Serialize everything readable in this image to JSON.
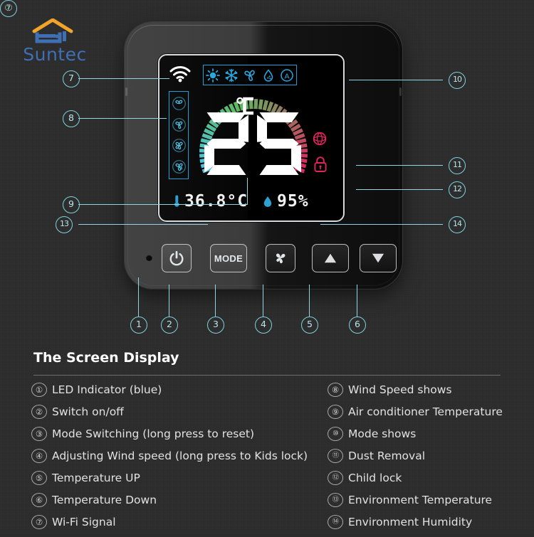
{
  "brand": {
    "name": "Suntec",
    "logo_colors": {
      "roof": "#f0a42a",
      "base": "#3f6fb5",
      "text": "#3f6fb5"
    }
  },
  "device": {
    "display": {
      "wifi_icon": "wifi-icon",
      "mode_icons": [
        {
          "name": "heat-mode-icon",
          "glyph": "sun"
        },
        {
          "name": "cool-mode-icon",
          "glyph": "snowflake"
        },
        {
          "name": "fan-mode-icon",
          "glyph": "fan"
        },
        {
          "name": "dehumidify-mode-icon",
          "glyph": "droplet"
        },
        {
          "name": "auto-mode-icon",
          "glyph": "A"
        }
      ],
      "fan_speed_icons": [
        {
          "name": "fan-speed-1-icon"
        },
        {
          "name": "fan-speed-2-icon"
        },
        {
          "name": "fan-speed-3-icon"
        },
        {
          "name": "fan-speed-4-icon"
        }
      ],
      "set_temperature": "25",
      "unit": "°C",
      "environment_temperature": "36.8°C",
      "environment_humidity": "95%",
      "dust_removal_icon": "dust-removal-icon",
      "child_lock_icon": "child-lock-icon",
      "arc_colors": {
        "cold": "#4ec3e8",
        "mid": "#5fb85f",
        "hot": "#e0245e"
      }
    },
    "buttons": [
      {
        "name": "power-button",
        "label": "",
        "glyph": "power"
      },
      {
        "name": "mode-button",
        "label": "MODE",
        "glyph": "text"
      },
      {
        "name": "fan-speed-button",
        "label": "",
        "glyph": "fan"
      },
      {
        "name": "temp-up-button",
        "label": "",
        "glyph": "up"
      },
      {
        "name": "temp-down-button",
        "label": "",
        "glyph": "down"
      }
    ],
    "led_indicator": "led-indicator"
  },
  "callouts": [
    {
      "id": "1",
      "pos": "bottom"
    },
    {
      "id": "2",
      "pos": "bottom"
    },
    {
      "id": "3",
      "pos": "bottom"
    },
    {
      "id": "4",
      "pos": "bottom"
    },
    {
      "id": "5",
      "pos": "bottom"
    },
    {
      "id": "6",
      "pos": "bottom"
    },
    {
      "id": "7",
      "pos": "left"
    },
    {
      "id": "8",
      "pos": "left"
    },
    {
      "id": "9",
      "pos": "left"
    },
    {
      "id": "13",
      "pos": "left"
    },
    {
      "id": "10",
      "pos": "right"
    },
    {
      "id": "11",
      "pos": "right"
    },
    {
      "id": "12",
      "pos": "right"
    },
    {
      "id": "14",
      "pos": "right"
    }
  ],
  "legend": {
    "title": "The Screen Display",
    "left": [
      {
        "num": "①",
        "text": "LED Indicator (blue)"
      },
      {
        "num": "②",
        "text": "Switch on/off"
      },
      {
        "num": "③",
        "text": "Mode Switching (long press to reset)"
      },
      {
        "num": "④",
        "text": "Adjusting Wind speed (long press to Kids lock)"
      },
      {
        "num": "⑤",
        "text": "Temperature UP"
      },
      {
        "num": "⑥",
        "text": "Temperature Down"
      },
      {
        "num": "⑦",
        "text": "Wi-Fi Signal"
      }
    ],
    "right": [
      {
        "num": "⑧",
        "text": "Wind Speed shows"
      },
      {
        "num": "⑨",
        "text": "Air conditioner Temperature"
      },
      {
        "num": "⑩",
        "text": "Mode shows"
      },
      {
        "num": "⑪",
        "text": "Dust Removal"
      },
      {
        "num": "⑫",
        "text": "Child lock"
      },
      {
        "num": "⑬",
        "text": "Environment Temperature"
      },
      {
        "num": "⑭",
        "text": "Environment Humidity"
      }
    ]
  }
}
